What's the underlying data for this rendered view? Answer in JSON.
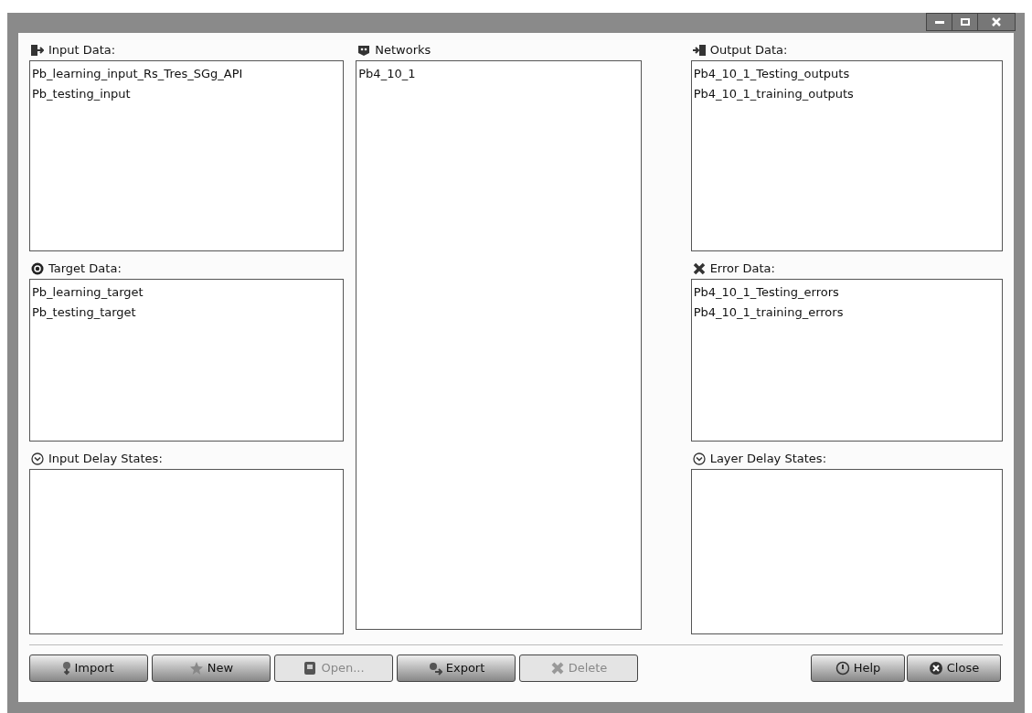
{
  "left_panels": [
    {
      "kind": "input",
      "label": "Input Data:",
      "items": [
        "Pb_learning_input_Rs_Tres_SGg_API",
        "Pb_testing_input"
      ]
    },
    {
      "kind": "target",
      "label": "Target Data:",
      "items": [
        "Pb_learning_target",
        "Pb_testing_target"
      ]
    },
    {
      "kind": "delay",
      "label": "Input Delay States:"
    }
  ],
  "networks": {
    "label": "Networks",
    "items": [
      "Pb4_10_1"
    ]
  },
  "right_panels": [
    {
      "kind": "output",
      "label": "Output Data:",
      "items": [
        "Pb4_10_1_Testing_outputs",
        "Pb4_10_1_training_outputs"
      ]
    },
    {
      "kind": "error",
      "label": "Error Data:",
      "items": [
        "Pb4_10_1_Testing_errors",
        "Pb4_10_1_training_errors"
      ]
    },
    {
      "kind": "delay",
      "label": "Layer Delay States:"
    }
  ],
  "buttons": [
    {
      "kind": "import",
      "label": "Import",
      "disabled": false
    },
    {
      "kind": "new",
      "label": "New",
      "disabled": false
    },
    {
      "kind": "open",
      "label": "Open...",
      "disabled": true
    },
    {
      "kind": "export",
      "label": "Export",
      "disabled": false
    },
    {
      "kind": "delete",
      "label": "Delete",
      "disabled": true
    }
  ],
  "right_buttons": [
    {
      "kind": "help",
      "label": "Help",
      "disabled": false
    },
    {
      "kind": "close",
      "label": "Close",
      "disabled": false
    }
  ]
}
